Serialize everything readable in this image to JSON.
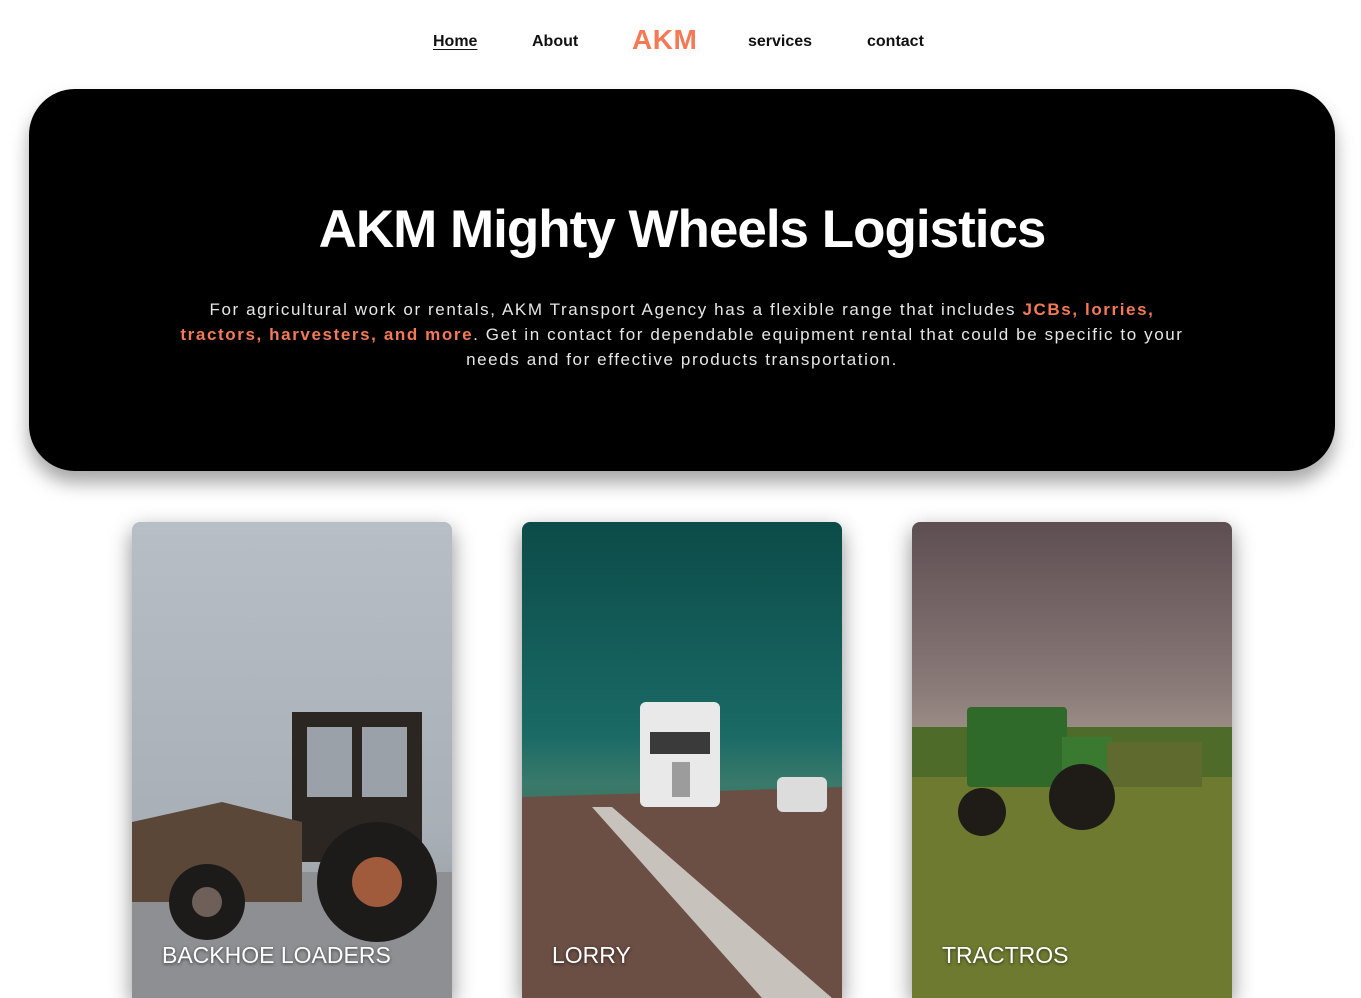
{
  "nav": {
    "home": "Home",
    "about": "About",
    "logo": "AKM",
    "services": "services",
    "contact": "contact"
  },
  "hero": {
    "title": "AKM Mighty Wheels Logistics",
    "desc_before": "For agricultural work or rentals, AKM Transport Agency has a flexible range that includes ",
    "desc_highlight": "JCBs, lorries, tractors, harvesters, and more",
    "desc_after": ". Get in contact for dependable equipment rental that could be specific to your needs and for effective products transportation."
  },
  "cards": [
    {
      "label": "BACKHOE LOADERS"
    },
    {
      "label": "LORRY"
    },
    {
      "label": "TRACTROS"
    }
  ],
  "colors": {
    "accent": "#f37a55",
    "hero_bg": "#000000"
  }
}
